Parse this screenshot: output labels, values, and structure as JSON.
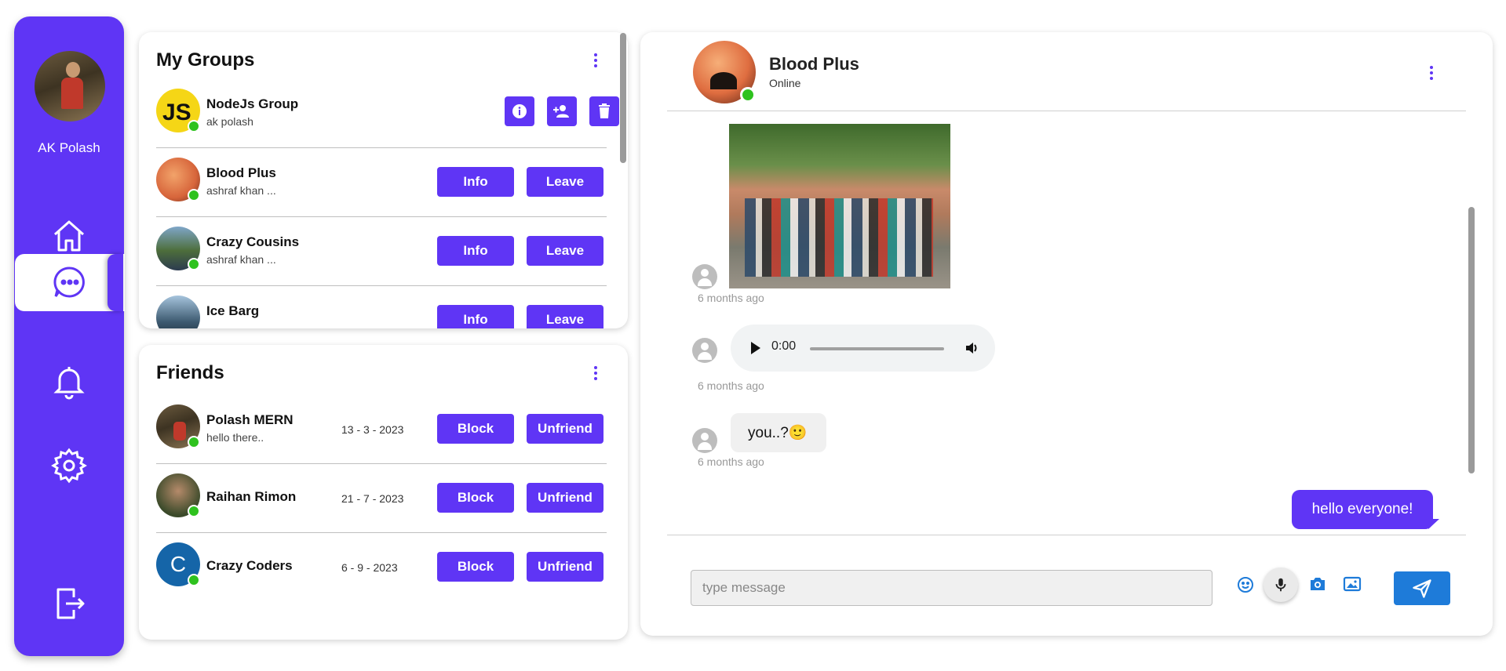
{
  "user": {
    "name": "AK Polash"
  },
  "sidebar": {
    "icons": [
      "home-icon",
      "chat-icon",
      "bell-icon",
      "gear-icon",
      "logout-icon"
    ],
    "active": "chat-icon",
    "accent": "#5f35f5"
  },
  "groups": {
    "title": "My Groups",
    "items": [
      {
        "name": "NodeJs Group",
        "sub": "ak polash",
        "owner": true
      },
      {
        "name": "Blood Plus",
        "sub": "ashraf khan ...",
        "info_label": "Info",
        "leave_label": "Leave"
      },
      {
        "name": "Crazy Cousins",
        "sub": "ashraf khan ...",
        "info_label": "Info",
        "leave_label": "Leave"
      },
      {
        "name": "Ice Barg",
        "sub": "",
        "info_label": "Info",
        "leave_label": "Leave"
      }
    ]
  },
  "friends": {
    "title": "Friends",
    "items": [
      {
        "name": "Polash MERN",
        "sub": "hello there..",
        "date": "13 - 3 - 2023",
        "block_label": "Block",
        "unfriend_label": "Unfriend"
      },
      {
        "name": "Raihan Rimon",
        "sub": "",
        "date": "21 - 7 - 2023",
        "block_label": "Block",
        "unfriend_label": "Unfriend"
      },
      {
        "name": "Crazy Coders",
        "sub": "",
        "date": "6 - 9 - 2023",
        "block_label": "Block",
        "unfriend_label": "Unfriend",
        "initial": "C"
      }
    ]
  },
  "chat": {
    "name": "Blood Plus",
    "status": "Online",
    "messages": [
      {
        "type": "image",
        "time": "6 months ago"
      },
      {
        "type": "audio",
        "current_time": "0:00",
        "time": "6 months ago"
      },
      {
        "type": "text",
        "text": "you..?🙂",
        "time": "6 months ago"
      },
      {
        "type": "text",
        "outgoing": true,
        "text": "hello everyone!"
      }
    ],
    "input_placeholder": "type message",
    "toolbar_icons": [
      "emoji-icon",
      "mic-icon",
      "camera-icon",
      "image-icon",
      "send-icon"
    ],
    "send_color": "#1e7bd9"
  }
}
